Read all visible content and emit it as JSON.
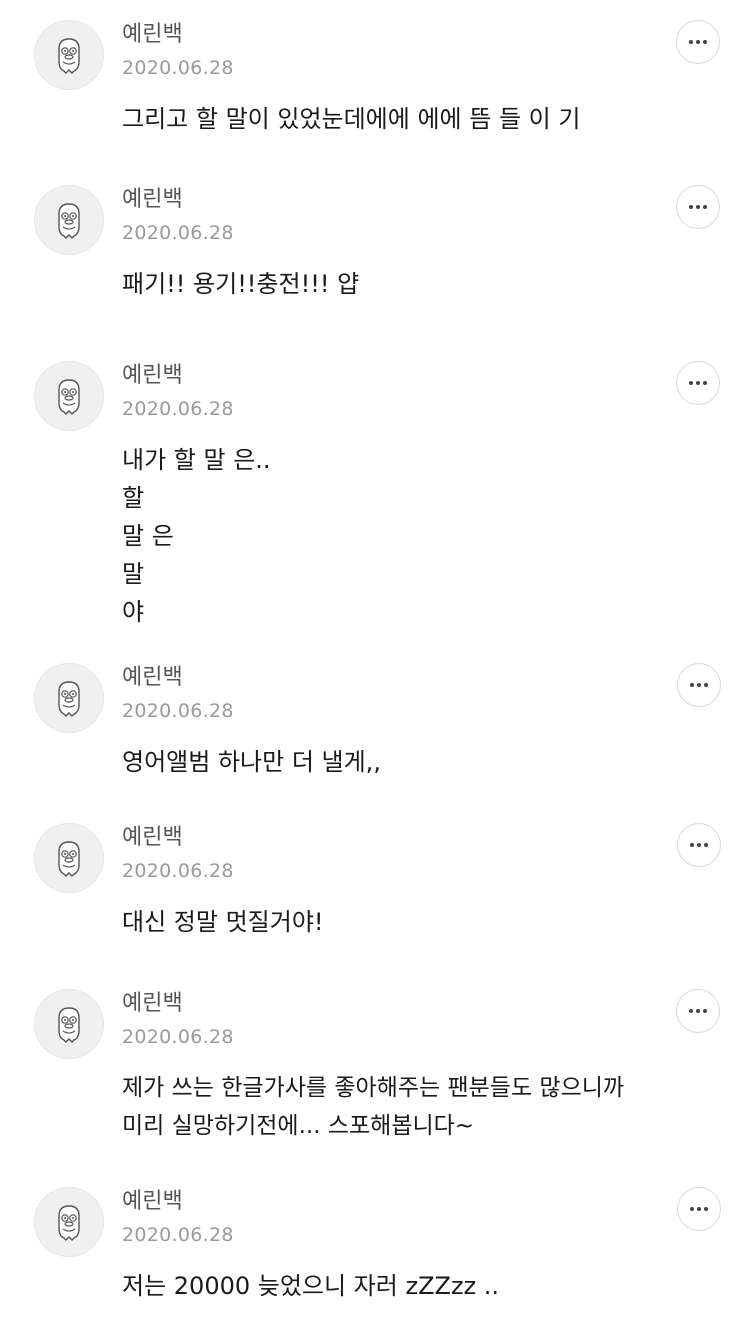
{
  "comments": [
    {
      "username": "예린백",
      "date": "2020.06.28",
      "avatar_icon": "cartoon-face-icon",
      "more_icon": "more-options-icon",
      "lines": [
        "그리고 할 말이 있었눈데에에 에에 뜸 들 이 기"
      ]
    },
    {
      "username": "예린백",
      "date": "2020.06.28",
      "avatar_icon": "cartoon-face-icon",
      "more_icon": "more-options-icon",
      "lines": [
        "패기!! 용기!!충전!!! 얍"
      ]
    },
    {
      "username": "예린백",
      "date": "2020.06.28",
      "avatar_icon": "cartoon-face-icon",
      "more_icon": "more-options-icon",
      "lines": [
        "내가 할 말 은..",
        "할",
        "말 은",
        "말",
        "야"
      ]
    },
    {
      "username": "예린백",
      "date": "2020.06.28",
      "avatar_icon": "cartoon-face-icon",
      "more_icon": "more-options-icon",
      "lines": [
        "영어앨범 하나만 더 낼게,,"
      ]
    },
    {
      "username": "예린백",
      "date": "2020.06.28",
      "avatar_icon": "cartoon-face-icon",
      "more_icon": "more-options-icon",
      "lines": [
        "대신 정말 멋질거야!"
      ]
    },
    {
      "username": "예린백",
      "date": "2020.06.28",
      "avatar_icon": "cartoon-face-icon",
      "more_icon": "more-options-icon",
      "lines": [
        "제가 쓰는 한글가사를 좋아해주는 팬분들도 많으니까",
        "미리 실망하기전에... 스포해봅니다~"
      ]
    },
    {
      "username": "예린백",
      "date": "2020.06.28",
      "avatar_icon": "cartoon-face-icon",
      "more_icon": "more-options-icon",
      "lines": [
        "저는 20000 늦었으니 자러 zZZzz .."
      ]
    }
  ]
}
